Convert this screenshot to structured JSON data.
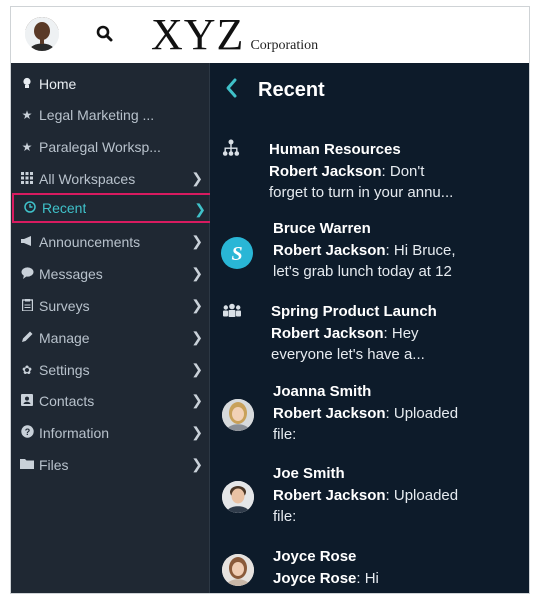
{
  "topbar": {
    "logo_main": "XYZ",
    "logo_sub": "Corporation"
  },
  "sidebar": {
    "items": [
      {
        "label": "Home",
        "icon": "lightbulb-icon"
      },
      {
        "label": "Legal Marketing ...",
        "icon": "star-icon"
      },
      {
        "label": "Paralegal Worksp...",
        "icon": "star-icon"
      },
      {
        "label": "All Workspaces",
        "icon": "grid-icon"
      },
      {
        "label": "Recent",
        "icon": "clock-icon"
      },
      {
        "label": "Announcements",
        "icon": "megaphone-icon"
      },
      {
        "label": "Messages",
        "icon": "chat-bubble-icon"
      },
      {
        "label": "Surveys",
        "icon": "clipboard-icon"
      },
      {
        "label": "Manage",
        "icon": "pencil-icon"
      },
      {
        "label": "Settings",
        "icon": "gear-icon"
      },
      {
        "label": "Contacts",
        "icon": "contact-card-icon"
      },
      {
        "label": "Information",
        "icon": "question-circle-icon"
      },
      {
        "label": "Files",
        "icon": "folder-icon"
      }
    ],
    "active": "Recent",
    "accent_color": "#3fc1c9",
    "highlight_color": "#d81b60"
  },
  "main": {
    "title": "Recent",
    "conversations": [
      {
        "title": "Human Resources",
        "sender": "Robert Jackson",
        "line1_rest": ": Don't",
        "line2": "forget to turn in your annu..."
      },
      {
        "title": "Bruce Warren",
        "sender": "Robert Jackson",
        "line1_rest": ": Hi Bruce,",
        "line2": "let's grab lunch today at 12"
      },
      {
        "title": "Spring Product Launch",
        "sender": "Robert Jackson",
        "line1_rest": ": Hey",
        "line2": "everyone let's have a..."
      },
      {
        "title": "Joanna Smith",
        "sender": "Robert Jackson",
        "line1_rest": ": Uploaded",
        "line2": "file:"
      },
      {
        "title": "Joe Smith",
        "sender": "Robert Jackson",
        "line1_rest": ": Uploaded",
        "line2": "file:"
      },
      {
        "title": "Joyce Rose",
        "sender": "Joyce Rose",
        "line1_rest": ": Hi",
        "line2": ""
      }
    ]
  }
}
